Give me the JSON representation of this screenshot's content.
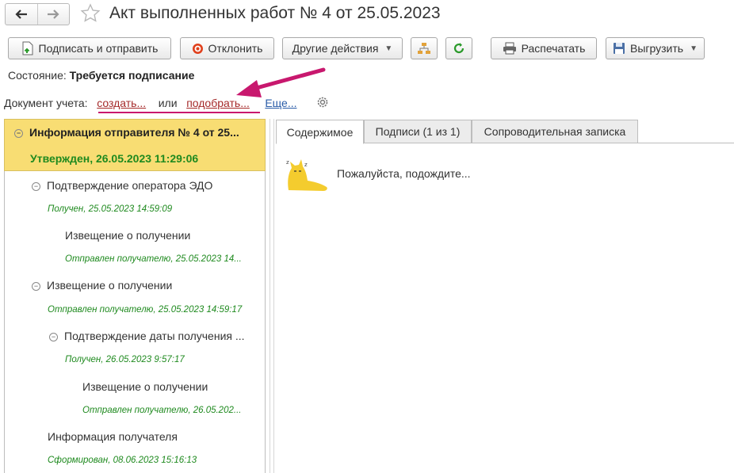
{
  "window": {
    "title": "Акт выполненных работ № 4 от 25.05.2023"
  },
  "toolbar": {
    "sign_send": "Подписать и отправить",
    "reject": "Отклонить",
    "other_actions": "Другие действия",
    "print": "Распечатать",
    "export": "Выгрузить"
  },
  "state": {
    "label": "Состояние:",
    "value": "Требуется подписание"
  },
  "accounting": {
    "label": "Документ учета:",
    "create": "создать...",
    "or": "или",
    "pick": "подобрать...",
    "more": "Еще..."
  },
  "tree": [
    {
      "title": "Информация отправителя № 4 от 25...",
      "status": "Утвержден, 26.05.2023 11:29:06"
    },
    {
      "title": "Подтверждение оператора ЭДО",
      "status": "Получен, 25.05.2023 14:59:09"
    },
    {
      "title": "Извещение о получении",
      "status": "Отправлен получателю, 25.05.2023 14..."
    },
    {
      "title": "Извещение о получении",
      "status": "Отправлен получателю, 25.05.2023 14:59:17"
    },
    {
      "title": "Подтверждение даты получения ...",
      "status": "Получен, 26.05.2023 9:57:17"
    },
    {
      "title": "Извещение о получении",
      "status": "Отправлен получателю, 26.05.202..."
    },
    {
      "title": "Информация получателя",
      "status": "Сформирован, 08.06.2023 15:16:13"
    }
  ],
  "tabs": [
    "Содержимое",
    "Подписи (1 из 1)",
    "Сопроводительная записка"
  ],
  "content": {
    "wait_text": "Пожалуйста, подождите..."
  },
  "colors": {
    "selected_bg": "#f8dd73",
    "status_green": "#1f8a1f",
    "arrow": "#c8186e"
  }
}
